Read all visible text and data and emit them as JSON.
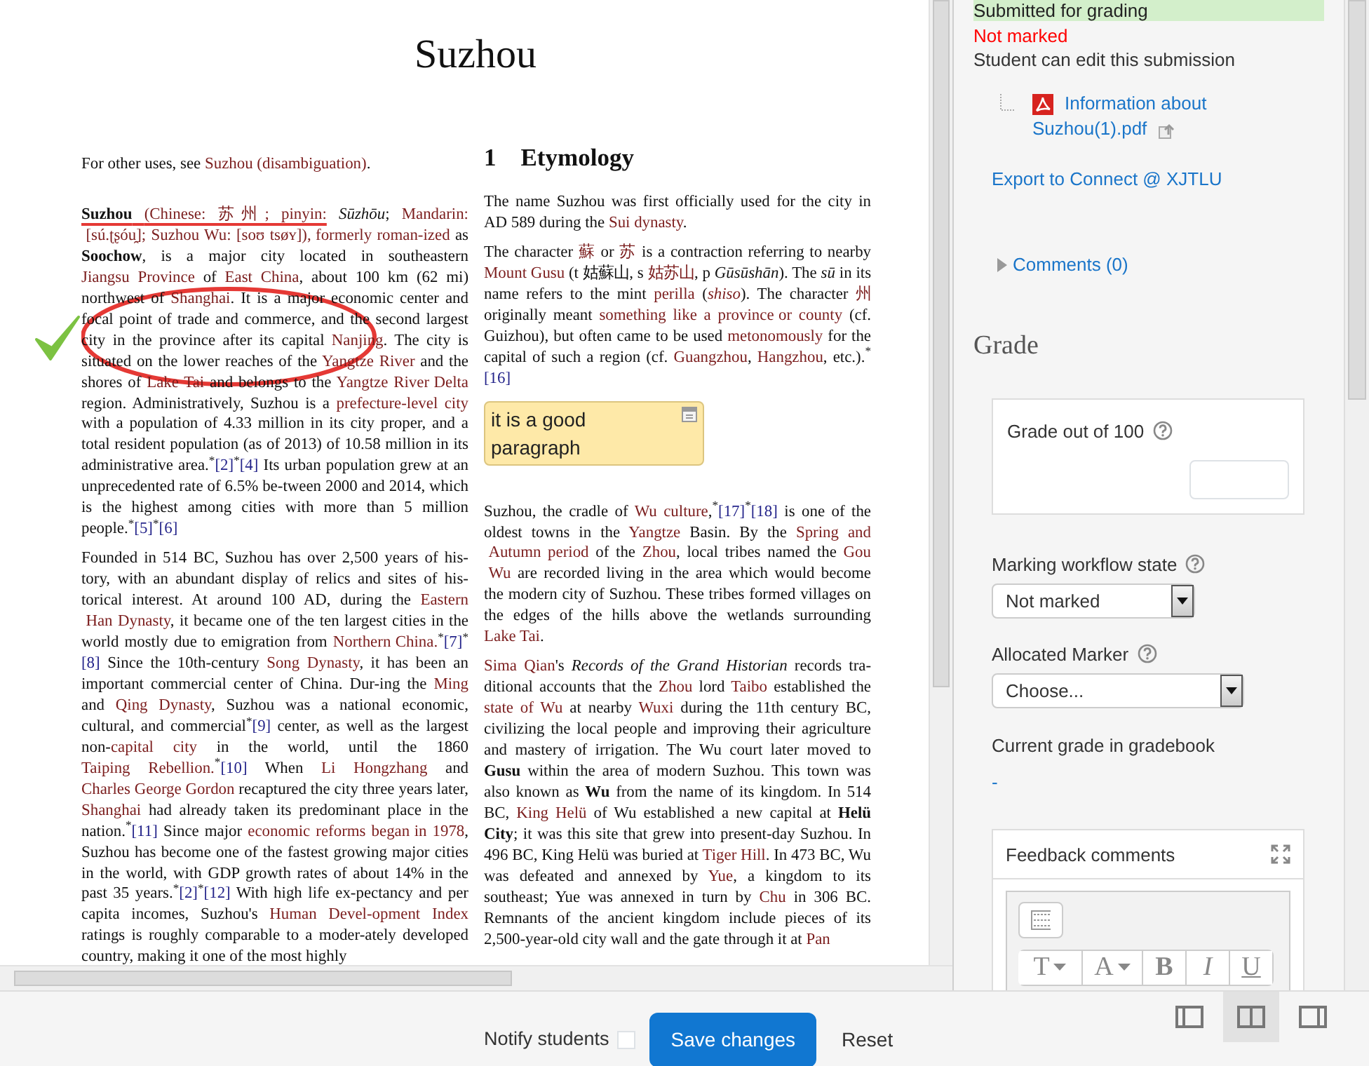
{
  "document": {
    "title": "Suzhou",
    "left_column": [
      {
        "kind": "paragraph",
        "segments": [
          "For other uses, see ",
          {
            "kind": "link",
            "text": "Suzhou (disambiguation)"
          },
          "."
        ]
      },
      {
        "kind": "paragraph",
        "segments": [
          "**Suzhou** ",
          {
            "kind": "link",
            "text": "(Chinese: 苏州; pinyin:"
          },
          " *Sūzhōu*; ",
          {
            "kind": "link",
            "text": "Mandarin:"
          },
          {
            "kind": "link",
            "text": "[sú.ʈʂóu̯]; Suzhou Wu: [soʊ tsøʏ]),"
          },
          {
            "kind": "link",
            "text": "formerly roman-ized"
          },
          " as **Soochow**, is a major city located in southeastern ",
          {
            "kind": "link",
            "text": "Jiangsu Province"
          },
          " of ",
          {
            "kind": "link",
            "text": "East China"
          },
          ", about 100 km (62 mi) northwest of ",
          {
            "kind": "link",
            "text": "Shanghai"
          },
          ". It is a major economic center and focal point of trade and commerce, and the second largest city in the province after its capital ",
          {
            "kind": "link",
            "text": "Nanjing"
          },
          ". The city is situated on the lower reaches of the ",
          {
            "kind": "link",
            "text": "Yangtze River"
          },
          " and the shores of ",
          {
            "kind": "link",
            "text": "Lake Tai"
          },
          " and belongs to the ",
          {
            "kind": "link",
            "text": "Yangtze River"
          },
          {
            "kind": "link",
            "text": "Delta"
          },
          " region.  Administratively, Suzhou is a ",
          {
            "kind": "link",
            "text": "prefecture-level city"
          },
          " with a population of 4.33 million in its city proper, and a total resident population (as of 2013) of 10.58 million in its administrative area.$^{*}$",
          {
            "kind": "ref",
            "text": "[2]"
          },
          "$^{*}$",
          {
            "kind": "ref",
            "text": "[4]"
          },
          " Its urban population grew at an unprecedented rate of 6.5% be-tween 2000 and 2014, which is the highest among cities with more than 5 million people.$^{*}$",
          {
            "kind": "ref",
            "text": "[5]"
          },
          "$^{*}$",
          {
            "kind": "ref",
            "text": "[6]"
          }
        ]
      },
      {
        "kind": "paragraph",
        "segments": [
          "Founded in 514 BC, Suzhou has over 2,500 years of his-tory, with an abundant display of relics and sites of his-torical interest.  At around 100 AD, during the ",
          {
            "kind": "link",
            "text": "Eastern"
          },
          {
            "kind": "link",
            "text": "Han Dynasty"
          },
          ", it became one of the ten largest cities in the world mostly due to emigration from ",
          {
            "kind": "link",
            "text": "Northern"
          },
          {
            "kind": "link",
            "text": "China."
          },
          "$^{*}$",
          {
            "kind": "ref",
            "text": "[7]"
          },
          "$^{*}$",
          {
            "kind": "ref",
            "text": "[8]"
          },
          " Since the 10th-century ",
          {
            "kind": "link",
            "text": "Song Dynasty"
          },
          ", it has been an important commercial center of China. Dur-ing the ",
          {
            "kind": "link",
            "text": "Ming"
          },
          " and ",
          {
            "kind": "link",
            "text": "Qing Dynasty"
          },
          ", Suzhou was a national economic, cultural, and commercial$^{*}$",
          {
            "kind": "ref",
            "text": "[9]"
          },
          " center, as well as the largest non-",
          {
            "kind": "link",
            "text": "capital city"
          },
          " in the world, until the 1860 ",
          {
            "kind": "link",
            "text": "Taiping Rebellion."
          },
          "$^{*}$",
          {
            "kind": "ref",
            "text": "[10]"
          },
          " When ",
          {
            "kind": "link",
            "text": "Li Hongzhang"
          },
          " and ",
          {
            "kind": "link",
            "text": "Charles George Gordon"
          },
          " recaptured the city three years later, ",
          {
            "kind": "link",
            "text": "Shanghai"
          },
          " had already taken its predominant place in the nation.$^{*}$",
          {
            "kind": "ref",
            "text": "[11]"
          },
          " Since major ",
          {
            "kind": "link",
            "text": "economic reforms began"
          },
          {
            "kind": "link",
            "text": "in 1978"
          },
          ", Suzhou has become one of the fastest growing major cities in the world, with GDP growth rates of about 14% in the past 35 years.$^{*}$",
          {
            "kind": "ref",
            "text": "[2]"
          },
          "$^{*}$",
          {
            "kind": "ref",
            "text": "[12]"
          },
          " With high life ex-pectancy and per capita incomes, Suzhou's ",
          {
            "kind": "link",
            "text": "Human Devel-opment Index"
          },
          " ratings is roughly comparable to a moder-ately developed country, making it one of the most highly"
        ]
      }
    ],
    "right_column": [
      {
        "kind": "heading",
        "number": "1",
        "text": "Etymology"
      },
      {
        "kind": "paragraph",
        "segments": [
          "The name Suzhou was first officially used for the city in AD 589 during the ",
          {
            "kind": "link",
            "text": "Sui dynasty"
          },
          "."
        ]
      },
      {
        "kind": "paragraph",
        "segments": [
          "The character ",
          {
            "kind": "link",
            "text": "蘇"
          },
          " or ",
          {
            "kind": "link",
            "text": "苏"
          },
          " is a contraction referring to nearby ",
          {
            "kind": "link",
            "text": "Mount Gusu"
          },
          " (t 姑蘇山, s ",
          {
            "kind": "link",
            "text": "姑苏山"
          },
          ", p *Gūsūshān*).  The *sū* in its name refers to the mint ",
          {
            "kind": "link",
            "text": "perilla"
          },
          " (",
          {
            "kind": "link",
            "text": "*shiso*"
          },
          ").  The character ",
          {
            "kind": "link",
            "text": "州"
          },
          " originally meant ",
          {
            "kind": "link",
            "text": "something like a province"
          },
          {
            "kind": "link",
            "text": "or county"
          },
          " (cf.  Guizhou), but often came to be used ",
          {
            "kind": "link",
            "text": "metonomously"
          },
          " for the capital of such a region (cf. ",
          {
            "kind": "link",
            "text": "Guangzhou"
          },
          ", ",
          {
            "kind": "link",
            "text": "Hangzhou"
          },
          ", etc.).$^{*}$",
          {
            "kind": "ref",
            "text": "[16]"
          }
        ]
      },
      {
        "kind": "note",
        "text": "it is a good paragraph"
      },
      {
        "kind": "paragraph",
        "segments": [
          "Suzhou, the cradle of ",
          {
            "kind": "link",
            "text": "Wu culture"
          },
          ",$^{*}$",
          {
            "kind": "ref",
            "text": "[17]"
          },
          "$^{*}$",
          {
            "kind": "ref",
            "text": "[18]"
          },
          " is one of the oldest towns in the ",
          {
            "kind": "link",
            "text": "Yangtze"
          },
          " Basin.  By the ",
          {
            "kind": "link",
            "text": "Spring and"
          },
          {
            "kind": "link",
            "text": "Autumn period"
          },
          " of the ",
          {
            "kind": "link",
            "text": "Zhou"
          },
          ", local tribes named the ",
          {
            "kind": "link",
            "text": "Gou"
          },
          {
            "kind": "link",
            "text": "Wu"
          },
          " are recorded living in the area which would become the modern city of Suzhou. These tribes formed villages on the edges of the hills above the wetlands surrounding ",
          {
            "kind": "link",
            "text": "Lake Tai"
          },
          "."
        ]
      },
      {
        "kind": "paragraph",
        "segments": [
          {
            "kind": "link",
            "text": "Sima Qian"
          },
          "'s *Records of the Grand Historian* records tra-ditional accounts that the ",
          {
            "kind": "link",
            "text": "Zhou"
          },
          " lord ",
          {
            "kind": "link",
            "text": "Taibo"
          },
          " established the ",
          {
            "kind": "link",
            "text": "state of Wu"
          },
          " at nearby ",
          {
            "kind": "link",
            "text": "Wuxi"
          },
          " during the 11th century BC, civilizing the local people and improving their agriculture and mastery of irrigation. The Wu court later moved to **Gusu** within the area of modern Suzhou. This town was also known as **Wu** from the name of its kingdom. In 514 BC, ",
          {
            "kind": "link",
            "text": "King Helü"
          },
          " of Wu established a new capital at **Helü City**; it was this site that grew into present-day Suzhou. In 496 BC, King Helü was buried at ",
          {
            "kind": "link",
            "text": "Tiger Hill"
          },
          ". In 473 BC, Wu was defeated and annexed by ",
          {
            "kind": "link",
            "text": "Yue"
          },
          ", a kingdom to its southeast; Yue was annexed in turn by ",
          {
            "kind": "link",
            "text": "Chu"
          },
          " in 306 BC. Remnants of the ancient kingdom include pieces of its 2,500-year-old city wall and the gate through it at ",
          {
            "kind": "link",
            "text": "Pan"
          }
        ]
      }
    ]
  },
  "submission": {
    "status": "Submitted for grading",
    "grading_status": "Not marked",
    "edit_note": "Student can edit this submission",
    "file": "Information about Suzhou(1).pdf",
    "export_link": "Export to Connect @ XJTLU",
    "comments": {
      "label": "Comments (0)",
      "expanded": false
    }
  },
  "grade": {
    "heading": "Grade",
    "grade_label": "Grade out of 100",
    "workflow_label": "Marking workflow state",
    "workflow_value": "Not marked",
    "marker_label": "Allocated Marker",
    "marker_value": "Choose...",
    "current_label": "Current grade in gradebook",
    "current_value": "-",
    "feedback_label": "Feedback comments",
    "editor_toolbar": [
      {
        "kind": "toggle"
      },
      {
        "kind": "menu",
        "text": "T"
      },
      {
        "kind": "menu",
        "text": "A"
      },
      {
        "kind": "bold",
        "text": "B"
      },
      {
        "kind": "italic",
        "text": "I"
      },
      {
        "kind": "underline",
        "text": "U"
      }
    ]
  },
  "footer": {
    "notify": {
      "label": "Notify students",
      "checked": false
    },
    "save_label": "Save changes",
    "reset_label": "Reset",
    "layouts": [
      {
        "kind": "left",
        "selected": false
      },
      {
        "kind": "both",
        "selected": true
      },
      {
        "kind": "right",
        "selected": false
      }
    ]
  }
}
